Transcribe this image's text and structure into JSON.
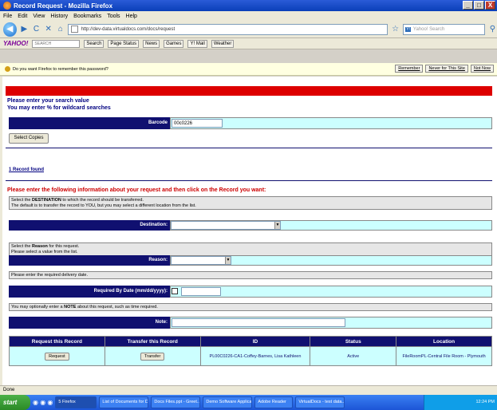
{
  "window": {
    "title": "Record Request - Mozilla Firefox",
    "buttons": [
      "_",
      "□",
      "X"
    ]
  },
  "menu": [
    "File",
    "Edit",
    "View",
    "History",
    "Bookmarks",
    "Tools",
    "Help"
  ],
  "nav": {
    "url": "http://dev-data.virtualdocs.com/docs/request",
    "search_placeholder": "Yahoo! Search"
  },
  "toolbar": {
    "yahoo_logo": "YAHOO!",
    "search_label": "SEARCH",
    "search_button": "Search",
    "items": [
      "Page Status",
      "News",
      "Games",
      "Y! Mail",
      "Weather"
    ]
  },
  "notification": {
    "text": "Do you want Firefox to remember this password?",
    "buttons": [
      "Remember",
      "Never for This Site",
      "Not Now"
    ]
  },
  "search": {
    "heading1": "Please enter your search value",
    "heading2": "You may enter % for wildcard searches",
    "barcode_label": "Barcode",
    "barcode_value": "00c0226",
    "select_copies": "Select Copies"
  },
  "results": {
    "found_label": "1 Record found"
  },
  "request": {
    "instruction": "Please enter the following information about your request and then click on the Record you want:",
    "destination_help_1": "Select the ",
    "destination_help_bold": "DESTINATION",
    "destination_help_2": " to which the record should be transferred.",
    "destination_help_line2": "The default is to transfer the record to YOU, but you may select a different location from the list.",
    "destination_label": "Destination:",
    "reason_help_1": "Select the ",
    "reason_help_bold": "Reason",
    "reason_help_2": " for this request.",
    "reason_help_line2": "Please select a value from the list.",
    "reason_label": "Reason:",
    "date_help": "Please enter the required delivery date.",
    "date_label": "Required By Date (mm/dd/yyyy):",
    "note_help_1": "You may optionally enter a ",
    "note_help_bold": "NOTE",
    "note_help_2": " about this request, such as time required.",
    "note_label": "Note:"
  },
  "table": {
    "headers": [
      "Request this Record",
      "Transfer this Record",
      "ID",
      "Status",
      "Location"
    ],
    "row": {
      "request_button": "Request",
      "transfer_button": "Transfer",
      "id": "PL00C0226-CA1-Coffey-Barnes, Lisa Kathleen",
      "status": "Active",
      "location": "FileRoomPL-Central File Room - Plymouth"
    }
  },
  "statusbar": {
    "text": "Done"
  },
  "taskbar": {
    "start": "start",
    "tasks": [
      "5 Firefox",
      "List of Documents for D...",
      "Docs Files.ppt - Greet...",
      "Demo Software Applicati...",
      "Adobe Reader",
      "VirtualDocs - test data..."
    ],
    "clock": "12:24 PM"
  }
}
